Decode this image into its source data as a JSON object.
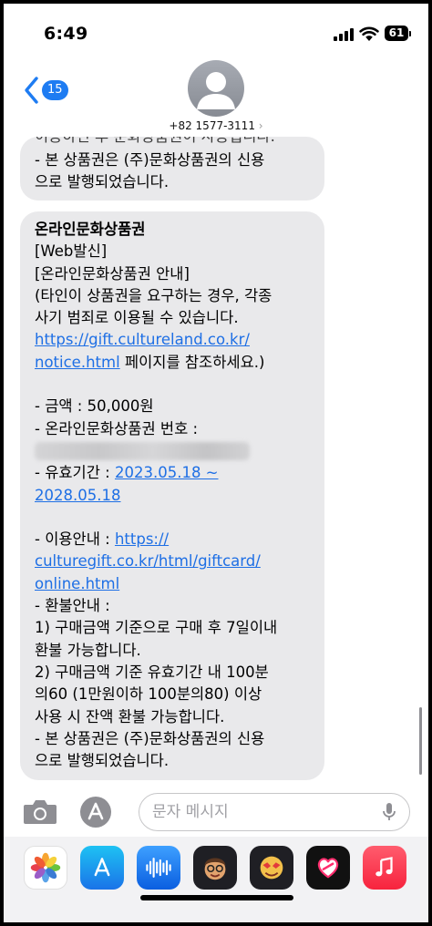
{
  "status_bar": {
    "time": "6:49",
    "battery": "61"
  },
  "header": {
    "unread_count": "15",
    "contact_number": "+82 1577-3111",
    "chevron": "›"
  },
  "messages": [
    {
      "partial_top": "이용하신 후 문화상품권이 사용됩니다.",
      "lines": [
        "- 본 상품권은 (주)문화상품권의 신용",
        "으로 발행되었습니다."
      ]
    },
    {
      "title": "온라인문화상품권",
      "lines": [
        "[Web발신]",
        "[온라인문화상품권 안내]",
        "(타인이 상품권을 요구하는 경우, 각종",
        "사기 범죄로 이용될 수 있습니다."
      ],
      "link1_part1": "https://gift.cultureland.co.kr/",
      "link1_part2": "notice.html",
      "link1_after": " 페이지를 참조하세요.)",
      "amount": "- 금액 : 50,000원",
      "pin_label": "- 온라인문화상품권 번호 :",
      "validity_label": "- 유효기간 : ",
      "validity_start": "2023.05.18 ~",
      "validity_end": "2028.05.18",
      "usage_label": "- 이용안내 : ",
      "usage_link_1": "https://",
      "usage_link_2": "culturegift.co.kr/html/giftcard/",
      "usage_link_3": "online.html",
      "refund_lines": [
        "- 환불안내 :",
        "1) 구매금액 기준으로 구매 후 7일이내",
        "환불 가능합니다.",
        "2) 구매금액 기준 유효기간 내 100분",
        "의60 (1만원이하 100분의80) 이상",
        "사용 시 잔액 환불 가능합니다.",
        "- 본 상품권은 (주)문화상품권의 신용",
        "으로 발행되었습니다."
      ]
    }
  ],
  "composer": {
    "placeholder": "문자 메시지"
  },
  "app_drawer": [
    "photos-app",
    "app-store",
    "audio-message",
    "memoji-1",
    "memoji-2",
    "digital-touch",
    "music-app"
  ],
  "colors": {
    "bubble": "#e9e9eb",
    "link": "#1e6fe5",
    "accent": "#1e7cf2"
  }
}
